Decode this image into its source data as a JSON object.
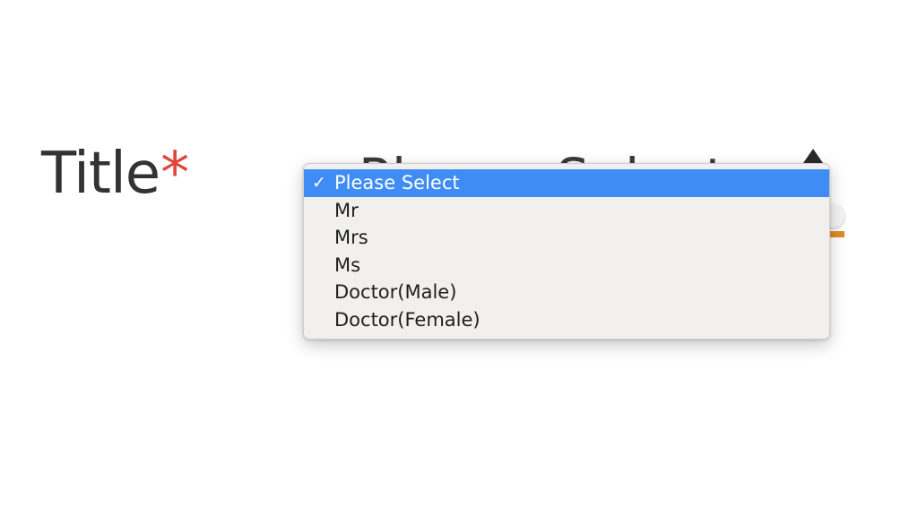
{
  "form": {
    "label": "Title",
    "required_mark": "*",
    "select_value": "Please Select"
  },
  "dropdown": {
    "selected_index": 0,
    "check_glyph": "✓",
    "options": [
      "Please Select",
      "Mr",
      "Mrs",
      "Ms",
      "Doctor(Male)",
      "Doctor(Female)"
    ]
  },
  "colors": {
    "highlight": "#3f8cf5",
    "required": "#e2433b",
    "accent": "#de8a2a"
  }
}
